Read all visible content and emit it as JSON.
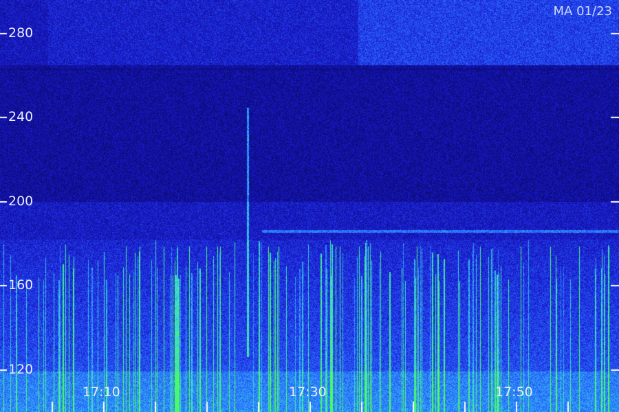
{
  "chart_data": {
    "type": "heatmap",
    "title": "",
    "stamp": "MA 01/23",
    "xlabel": "",
    "ylabel": "",
    "x_ticks": [
      "17:10",
      "17:30",
      "17:50"
    ],
    "y_ticks": [
      280,
      240,
      200,
      160,
      120
    ],
    "ylim": [
      113,
      296
    ],
    "xlim": [
      "17:00",
      "18:00"
    ],
    "grid": false,
    "colormap": [
      "#0a0a6e",
      "#1a1ad0",
      "#2a6cff",
      "#36d8e8",
      "#4cff5a"
    ],
    "features": {
      "persistent_band_value": 186,
      "bright_burst_time": "17:24",
      "bright_burst_top": 245,
      "lower_band_range": [
        113,
        182
      ],
      "quiet_band_range": [
        200,
        265
      ]
    }
  }
}
